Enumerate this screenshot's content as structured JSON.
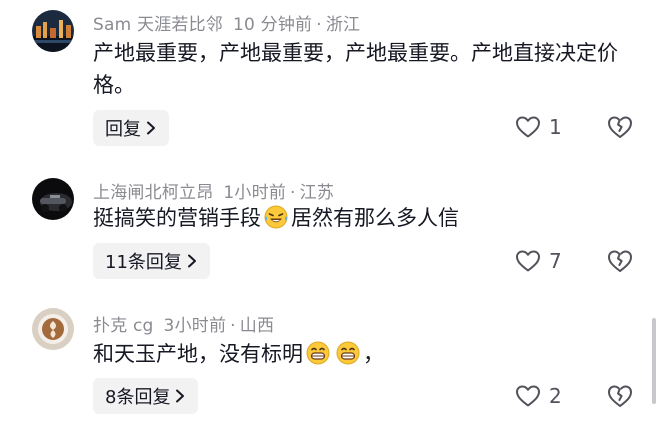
{
  "comments": [
    {
      "author": "Sam 天涯若比邻",
      "time": "10 分钟前",
      "location": "浙江",
      "text": "产地最重要，产地最重要，产地最重要。产地直接决定价格。",
      "reply_label": "回复",
      "likes": "1",
      "avatar": "night-city-avatar"
    },
    {
      "author": "上海闸北柯立昂",
      "time": "1小时前",
      "location": "江苏",
      "text_before": "挺搞笑的营销手段",
      "emoji": "laughing-tears-emoji",
      "text_after": "居然有那么多人信",
      "reply_label": "11条回复",
      "likes": "7",
      "avatar": "dark-car-avatar"
    },
    {
      "author": "扑克 cg",
      "time": "3小时前",
      "location": "山西",
      "text_before": "和天玉产地，没有标明",
      "emoji": "grinning-emoji",
      "text_after": "，",
      "reply_label": "8条回复",
      "likes": "2",
      "avatar": "latte-art-avatar"
    }
  ],
  "separator": "·"
}
